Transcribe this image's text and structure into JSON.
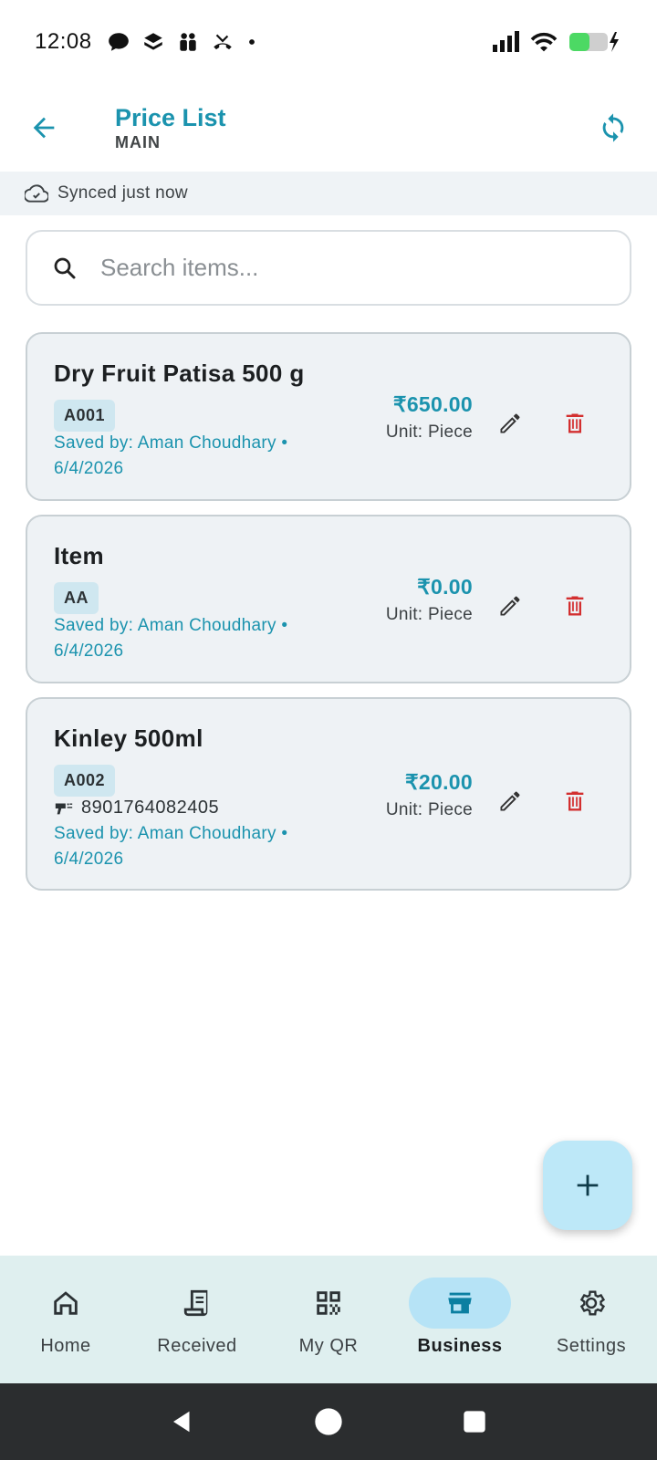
{
  "status_bar": {
    "time": "12:08",
    "battery_color": "#4cd964"
  },
  "app_bar": {
    "title": "Price List",
    "subtitle": "MAIN"
  },
  "sync": {
    "text": "Synced just now"
  },
  "search": {
    "placeholder": "Search items..."
  },
  "items": [
    {
      "name": "Dry Fruit Patisa 500 g",
      "code": "A001",
      "barcode": "",
      "saved_by_line1": "Saved by: Aman Choudhary •",
      "saved_by_line2": "6/4/2026",
      "price": "₹650.00",
      "unit": "Unit: Piece"
    },
    {
      "name": "Item",
      "code": "AA",
      "barcode": "",
      "saved_by_line1": "Saved by: Aman Choudhary •",
      "saved_by_line2": "6/4/2026",
      "price": "₹0.00",
      "unit": "Unit: Piece"
    },
    {
      "name": "Kinley 500ml",
      "code": "A002",
      "barcode": "8901764082405",
      "saved_by_line1": "Saved by: Aman Choudhary •",
      "saved_by_line2": "6/4/2026",
      "price": "₹20.00",
      "unit": "Unit: Piece"
    }
  ],
  "nav": {
    "items": [
      {
        "label": "Home",
        "icon": "home-icon"
      },
      {
        "label": "Received",
        "icon": "receipt-icon"
      },
      {
        "label": "My QR",
        "icon": "qr-code-icon"
      },
      {
        "label": "Business",
        "icon": "store-icon",
        "active": true
      },
      {
        "label": "Settings",
        "icon": "gear-icon"
      }
    ]
  },
  "colors": {
    "accent": "#1b93ae",
    "delete": "#d32f2f",
    "fab": "#bde8f8",
    "nav_bg": "#dfefef"
  }
}
